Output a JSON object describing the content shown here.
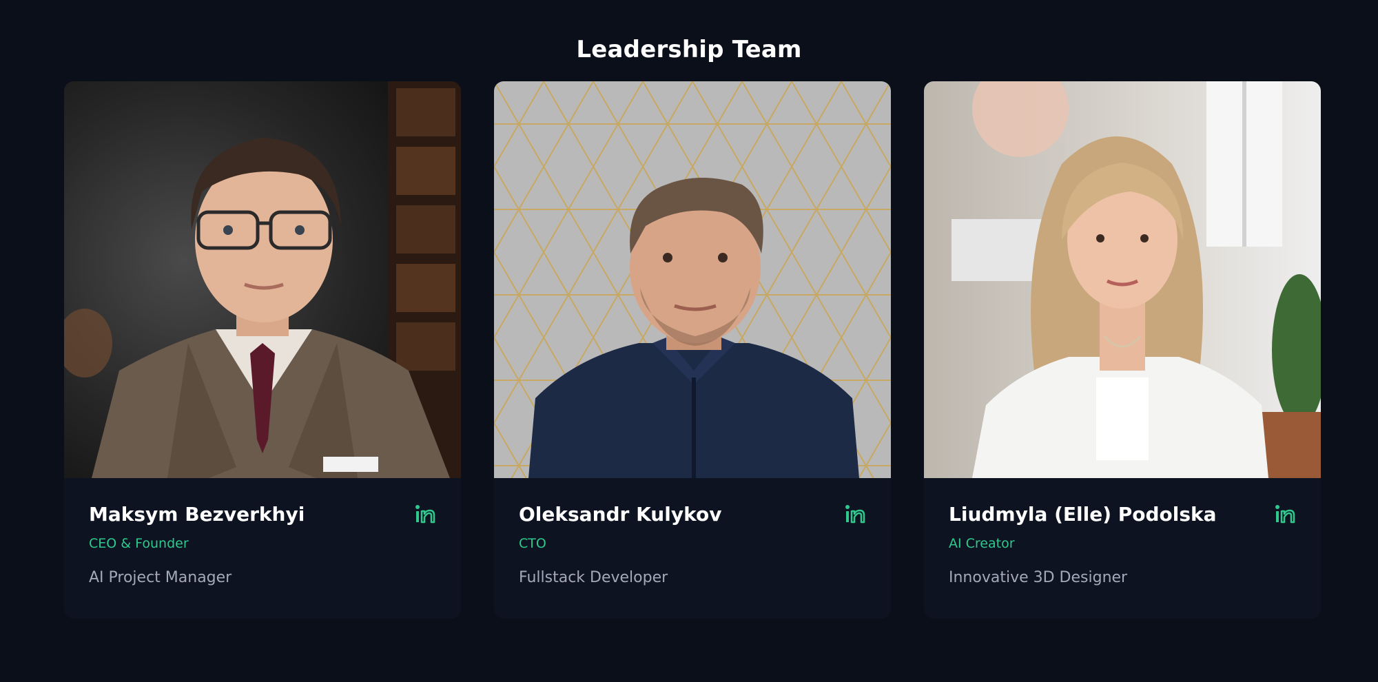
{
  "section": {
    "title": "Leadership Team"
  },
  "colors": {
    "background": "#0b0f1a",
    "card": "#0e1321",
    "accent": "#2fc98d",
    "muted": "#a3a9b8"
  },
  "members": [
    {
      "name": "Maksym Bezverkhyi",
      "role": "CEO & Founder",
      "description": "AI Project Manager",
      "icon": "linkedin-icon"
    },
    {
      "name": "Oleksandr Kulykov",
      "role": "CTO",
      "description": "Fullstack Developer",
      "icon": "linkedin-icon"
    },
    {
      "name": "Liudmyla (Elle) Podolska",
      "role": "AI Creator",
      "description": "Innovative 3D Designer",
      "icon": "linkedin-icon"
    }
  ]
}
